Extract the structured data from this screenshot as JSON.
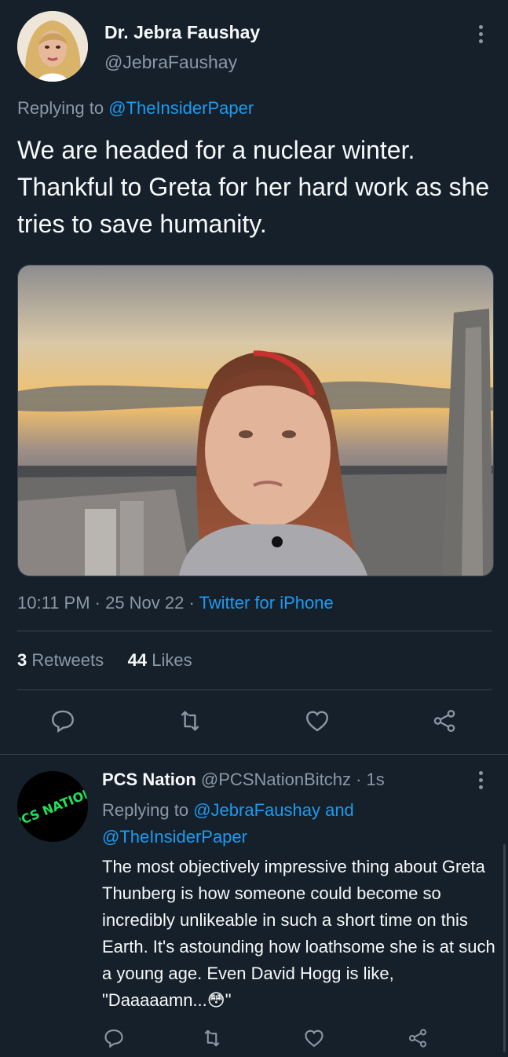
{
  "tweet": {
    "display_name": "Dr. Jebra Faushay",
    "handle": "@JebraFaushay",
    "replying_prefix": "Replying to",
    "replying_to": "@TheInsiderPaper",
    "text": "We are headed for a nuclear winter. Thankful to Greta for her hard work as she tries to save humanity.",
    "time_date": "10:11 PM · 25 Nov 22 · ",
    "source": "Twitter for iPhone",
    "retweets_count": "3",
    "retweets_label": "Retweets",
    "likes_count": "44",
    "likes_label": "Likes"
  },
  "reply": {
    "display_name": "PCS Nation",
    "handle": "@PCSNationBitchz",
    "time": " · 1s",
    "replying_prefix": "Replying to",
    "replying_to_1": "@JebraFaushay",
    "and": "and",
    "replying_to_2": "@TheInsiderPaper",
    "text": "The most objectively impressive thing about Greta Thunberg is how someone could become so incredibly unlikeable in such a short time on this Earth. It's astounding how loathsome she is at such a young age. Even David Hogg is like, \"Daaaaamn...😳\"",
    "avatar_text": "PCS NATION"
  },
  "icons": [
    "reply-icon",
    "retweet-icon",
    "like-icon",
    "share-icon",
    "more-icon"
  ],
  "colors": {
    "background": "#15202b",
    "accent": "#1d9bf0",
    "muted": "#8b98a5",
    "avatar2_text": "#22e05a"
  }
}
